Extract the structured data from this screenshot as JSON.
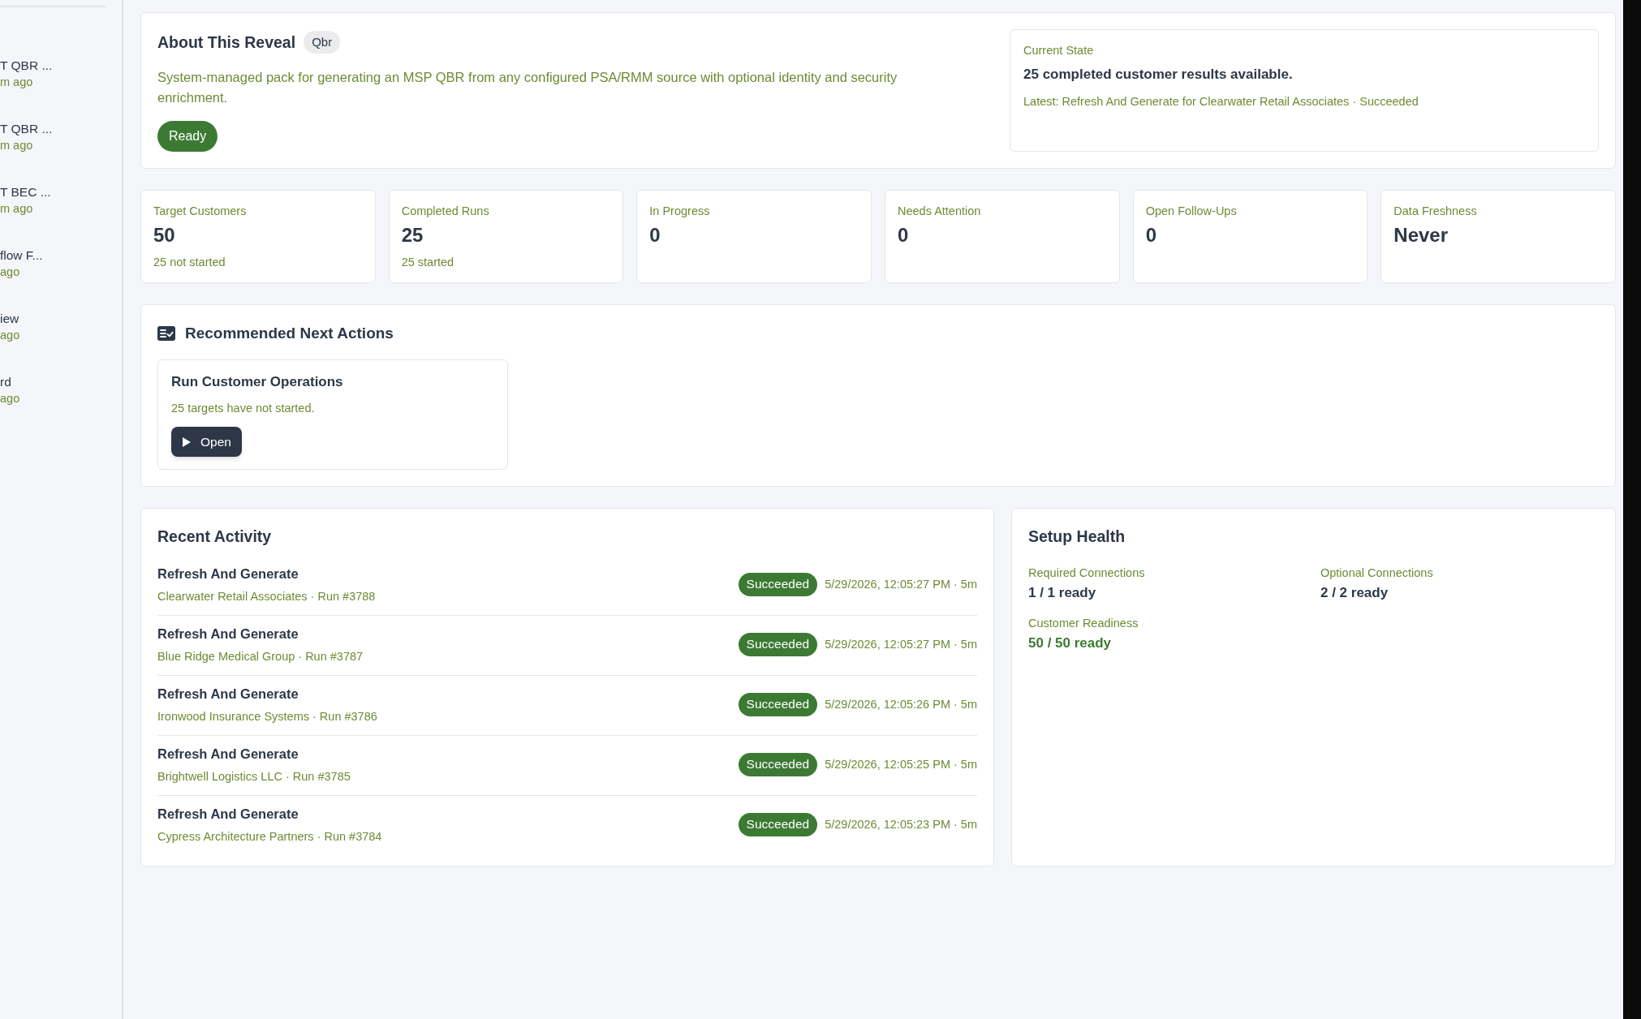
{
  "sidebar": {
    "items": [
      {
        "title": "T QBR ...",
        "time": "m ago"
      },
      {
        "title": "T QBR ...",
        "time": "m ago"
      },
      {
        "title": "T BEC ...",
        "time": "m ago"
      },
      {
        "title": "flow F...",
        "time": "ago"
      },
      {
        "title": "iew",
        "time": "ago"
      },
      {
        "title": "rd",
        "time": "ago"
      }
    ]
  },
  "about": {
    "title": "About This Reveal",
    "badge": "Qbr",
    "description": "System-managed pack for generating an MSP QBR from any configured PSA/RMM source with optional identity and security enrichment.",
    "status": "Ready",
    "current_state": {
      "label": "Current State",
      "headline": "25 completed customer results available.",
      "latest": "Latest: Refresh And Generate for Clearwater Retail Associates · Succeeded"
    }
  },
  "stats": [
    {
      "label": "Target Customers",
      "value": "50",
      "detail": "25 not started"
    },
    {
      "label": "Completed Runs",
      "value": "25",
      "detail": "25 started"
    },
    {
      "label": "In Progress",
      "value": "0"
    },
    {
      "label": "Needs Attention",
      "value": "0"
    },
    {
      "label": "Open Follow-Ups",
      "value": "0"
    },
    {
      "label": "Data Freshness",
      "value": "Never"
    }
  ],
  "recommended": {
    "title": "Recommended Next Actions",
    "actions": [
      {
        "title": "Run Customer Operations",
        "description": "25 targets have not started.",
        "button": "Open"
      }
    ]
  },
  "recent_activity": {
    "title": "Recent Activity",
    "items": [
      {
        "title": "Refresh And Generate",
        "subtitle": "Clearwater Retail Associates · Run #3788",
        "status": "Succeeded",
        "time": "5/29/2026, 12:05:27 PM · 5m"
      },
      {
        "title": "Refresh And Generate",
        "subtitle": "Blue Ridge Medical Group · Run #3787",
        "status": "Succeeded",
        "time": "5/29/2026, 12:05:27 PM · 5m"
      },
      {
        "title": "Refresh And Generate",
        "subtitle": "Ironwood Insurance Systems · Run #3786",
        "status": "Succeeded",
        "time": "5/29/2026, 12:05:26 PM · 5m"
      },
      {
        "title": "Refresh And Generate",
        "subtitle": "Brightwell Logistics LLC · Run #3785",
        "status": "Succeeded",
        "time": "5/29/2026, 12:05:25 PM · 5m"
      },
      {
        "title": "Refresh And Generate",
        "subtitle": "Cypress Architecture Partners · Run #3784",
        "status": "Succeeded",
        "time": "5/29/2026, 12:05:23 PM · 5m"
      }
    ]
  },
  "setup_health": {
    "title": "Setup Health",
    "metrics": [
      {
        "label": "Required Connections",
        "value": "1 / 1 ready",
        "highlighted": false
      },
      {
        "label": "Optional Connections",
        "value": "2 / 2 ready",
        "highlighted": false
      },
      {
        "label": "Customer Readiness",
        "value": "50 / 50 ready",
        "highlighted": true
      }
    ]
  }
}
